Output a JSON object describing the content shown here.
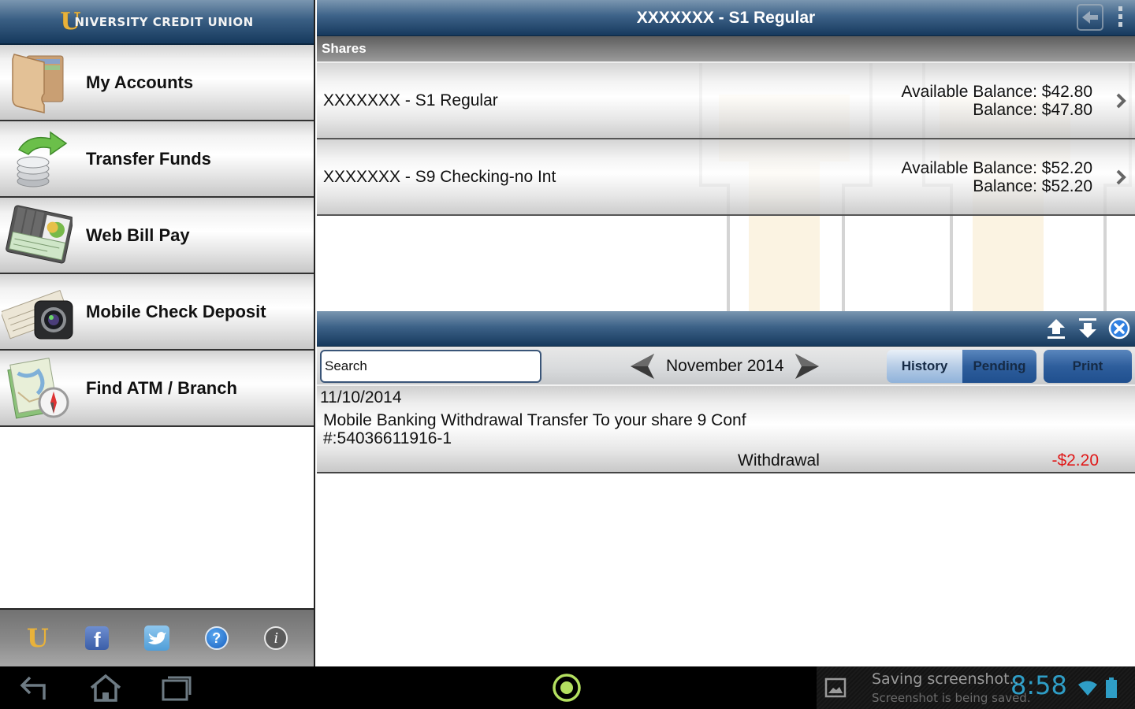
{
  "brand": {
    "logo_letter": "U",
    "name": "NIVERSITY CREDIT UNION"
  },
  "sidebar": {
    "items": [
      {
        "label": "My Accounts",
        "icon": "wallet-icon"
      },
      {
        "label": "Transfer Funds",
        "icon": "transfer-coins-icon"
      },
      {
        "label": "Web Bill Pay",
        "icon": "checkbook-icon"
      },
      {
        "label": "Mobile Check Deposit",
        "icon": "camera-check-icon"
      },
      {
        "label": "Find ATM / Branch",
        "icon": "map-compass-icon"
      }
    ],
    "footer_icons": [
      {
        "name": "university-logo-icon",
        "glyph": "U"
      },
      {
        "name": "facebook-icon",
        "glyph": "f"
      },
      {
        "name": "twitter-icon",
        "glyph": "t"
      },
      {
        "name": "help-icon",
        "glyph": "?"
      },
      {
        "name": "info-icon",
        "glyph": "i"
      }
    ]
  },
  "header": {
    "title": "XXXXXXX - S1 Regular"
  },
  "shares": {
    "section_label": "Shares",
    "accounts": [
      {
        "name": "XXXXXXX - S1 Regular",
        "available_label": "Available Balance: $42.80",
        "balance_label": "Balance: $47.80"
      },
      {
        "name": "XXXXXXX - S9 Checking-no Int",
        "available_label": "Available Balance: $52.20",
        "balance_label": "Balance: $52.20"
      }
    ]
  },
  "transactions": {
    "search_placeholder": "Search",
    "month": "November 2014",
    "tabs": {
      "history": "History",
      "pending": "Pending"
    },
    "print_label": "Print",
    "items": [
      {
        "date": "11/10/2014",
        "description": "Mobile Banking Withdrawal Transfer To your share 9  Conf #:54036611916-1",
        "type": "Withdrawal",
        "amount": "-$2.20"
      }
    ]
  },
  "status_bar": {
    "notification_title": "Saving screenshot...",
    "notification_subtitle": "Screenshot is being saved.",
    "time": "8:58"
  },
  "colors": {
    "brand_navy": "#16395d",
    "brand_gold": "#e9b23a",
    "negative_amount": "#e01818",
    "clock_blue": "#33b5e5",
    "home_ring": "#b4e060"
  }
}
